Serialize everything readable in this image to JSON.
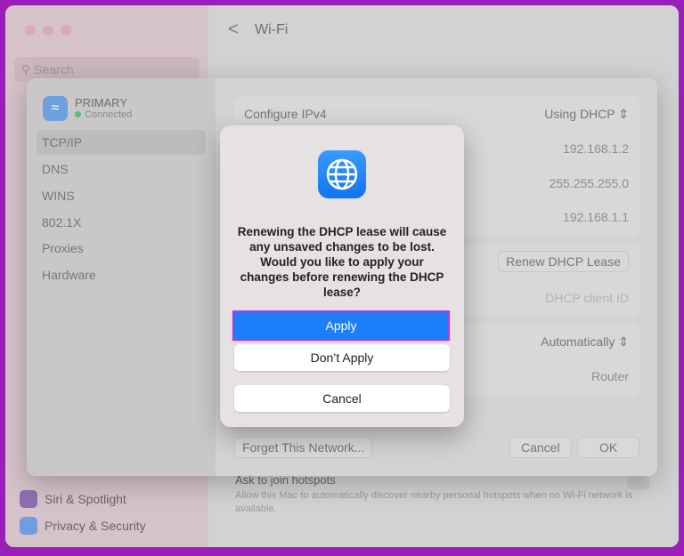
{
  "sidebar": {
    "search_placeholder": "Search",
    "items": [
      {
        "label": "Siri & Spotlight",
        "color": "#8d6fb0"
      },
      {
        "label": "Privacy & Security",
        "color": "#6e9de0"
      }
    ]
  },
  "header": {
    "title": "Wi-Fi",
    "back": "<"
  },
  "hotspots": {
    "title": "Ask to join hotspots",
    "desc": "Allow this Mac to automatically discover nearby personal hotspots when no Wi-Fi network is available."
  },
  "sheet": {
    "network": {
      "name": "PRIMARY",
      "status": "Connected"
    },
    "tabs": [
      "TCP/IP",
      "DNS",
      "WINS",
      "802.1X",
      "Proxies",
      "Hardware"
    ],
    "selected_tab": "TCP/IP",
    "configure_ipv4": {
      "label": "Configure IPv4",
      "value": "Using DHCP"
    },
    "ip_address": "192.168.1.2",
    "subnet": "255.255.255.0",
    "router": "192.168.1.1",
    "renew_button": "Renew DHCP Lease",
    "client_id_placeholder": "DHCP client ID",
    "configure_ipv6": "Automatically",
    "router_v6": "Router",
    "forget_button": "Forget This Network...",
    "cancel_button": "Cancel",
    "ok_button": "OK"
  },
  "dialog": {
    "message": "Renewing the DHCP lease will cause any unsaved changes to be lost. Would you like to apply your changes before renewing the DHCP lease?",
    "apply": "Apply",
    "dont_apply": "Don’t Apply",
    "cancel": "Cancel",
    "accent": "#1a7ff8",
    "highlight": "#c030e8"
  },
  "icons": {
    "globe": "globe-icon",
    "wifi": "wifi-icon"
  }
}
